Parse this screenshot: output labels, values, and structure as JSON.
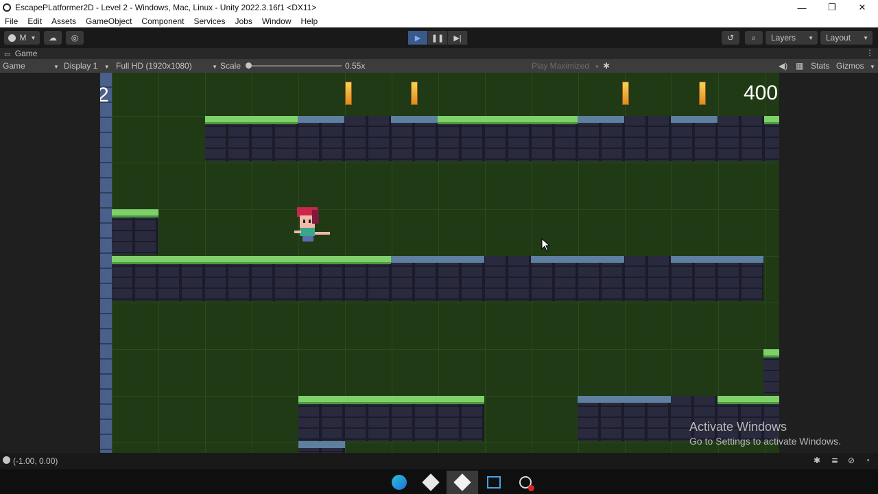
{
  "window": {
    "title": "EscapePLatformer2D - Level 2 - Windows, Mac, Linux - Unity 2022.3.16f1 <DX11>",
    "minimize": "—",
    "restore": "❐",
    "close": "✕"
  },
  "menu": [
    "File",
    "Edit",
    "Assets",
    "GameObject",
    "Component",
    "Services",
    "Jobs",
    "Window",
    "Help"
  ],
  "toolbar": {
    "account_label": "M",
    "layers_label": "Layers",
    "layout_label": "Layout",
    "play_state": "playing"
  },
  "tab": {
    "label": "Game"
  },
  "game_bar": {
    "view_mode": "Game",
    "display": "Display 1",
    "resolution": "Full HD (1920x1080)",
    "scale_label": "Scale",
    "scale_value": "0.55x",
    "play_maximized": "Play Maximized",
    "stats": "Stats",
    "gizmos": "Gizmos"
  },
  "hud": {
    "lives": "2",
    "score": "400"
  },
  "watermark": {
    "line1": "Activate Windows",
    "line2": "Go to Settings to activate Windows."
  },
  "status": {
    "coordinates": "(-1.00, 0.00)"
  },
  "colors": {
    "play_active": "#3a5a8a",
    "grass": "#7fd06a",
    "stone": "#2a2a3e",
    "background": "#1f3a14"
  }
}
